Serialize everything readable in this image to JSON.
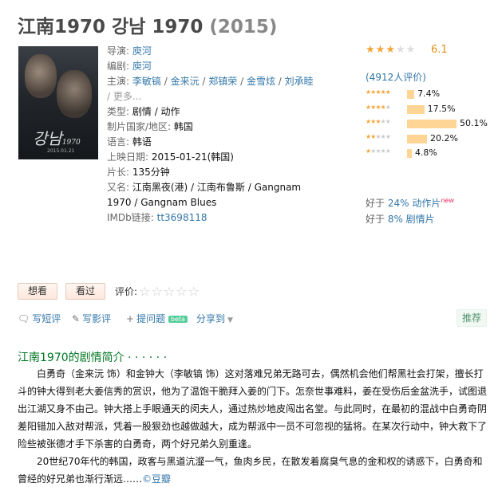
{
  "title": {
    "main": "江南1970 강남 1970",
    "year": "(2015)"
  },
  "poster": {
    "text": "강남",
    "sub": "1970",
    "date": "2015.01.21"
  },
  "info": {
    "director_label": "导演:",
    "director": "庾河",
    "writer_label": "编剧:",
    "writer": "庾河",
    "cast_label": "主演:",
    "cast": [
      "李敏镐",
      "金来沅",
      "郑镇荣",
      "金雪炫",
      "刘承睦"
    ],
    "cast_sep": " / ",
    "more": "/ 更多...",
    "genre_label": "类型:",
    "genre": "剧情 / 动作",
    "country_label": "制片国家/地区:",
    "country": "韩国",
    "language_label": "语言:",
    "language": "韩语",
    "release_label": "上映日期:",
    "release": "2015-01-21(韩国)",
    "runtime_label": "片长:",
    "runtime": "135分钟",
    "aka_label": "又名:",
    "aka": "江南黑夜(港) / 江南布鲁斯 / Gangnam 1970 / Gangnam Blues",
    "imdb_label": "IMDb链接:",
    "imdb": "tt3698118"
  },
  "rating": {
    "score": "6.1",
    "stars_on": 3,
    "count": "(4912人评价)",
    "distribution": [
      {
        "stars": 5,
        "percent": 7.4,
        "label": "7.4%"
      },
      {
        "stars": 4,
        "percent": 17.5,
        "label": "17.5%"
      },
      {
        "stars": 3,
        "percent": 50.1,
        "label": "50.1%"
      },
      {
        "stars": 2,
        "percent": 20.2,
        "label": "20.2%"
      },
      {
        "stars": 1,
        "percent": 4.8,
        "label": "4.8%"
      }
    ]
  },
  "better_than": [
    {
      "prefix": "好于 ",
      "link": "24% 动作片",
      "badge": "new"
    },
    {
      "prefix": "好于 ",
      "link": "8% 剧情片",
      "badge": ""
    }
  ],
  "actions": {
    "want": "想看",
    "seen": "看过",
    "rate_label": "评价:"
  },
  "tools": {
    "short_review": "写短评",
    "review": "写影评",
    "question": "提问题",
    "beta": "beta",
    "share": "分享到",
    "recommend": "推荐"
  },
  "synopsis": {
    "title": "江南1970的剧情简介 · · · · · ·",
    "p1": "白勇奇（金来沅 饰）和金钟大（李敏镐 饰）这对落难兄弟无路可去，偶然机会他们帮黑社会打架，擅长打斗的钟大得到老大姜信秀的赏识，他为了温饱干脆拜入姜的门下。怎奈世事难料，姜在受伤后金盆洗手，试图退出江湖又身不由己。钟大搭上手眼通天的闵夫人，通过热炒地皮闯出名堂。与此同时，在最初的混战中白勇奇阴差阳错加入敌对帮派，凭着一股狠劲也越做越大，成为帮派中一员不可忽视的猛将。在某次行动中，钟大救下了险些被张德才手下杀害的白勇奇，两个好兄弟久别重逢。",
    "p2": "20世纪70年代的韩国，政客与黑道沆瀣一气，鱼肉乡民，在散发着腐臭气息的金和权的诱惑下，白勇奇和曾经的好兄弟也渐行渐远……",
    "source": "©豆瓣"
  }
}
